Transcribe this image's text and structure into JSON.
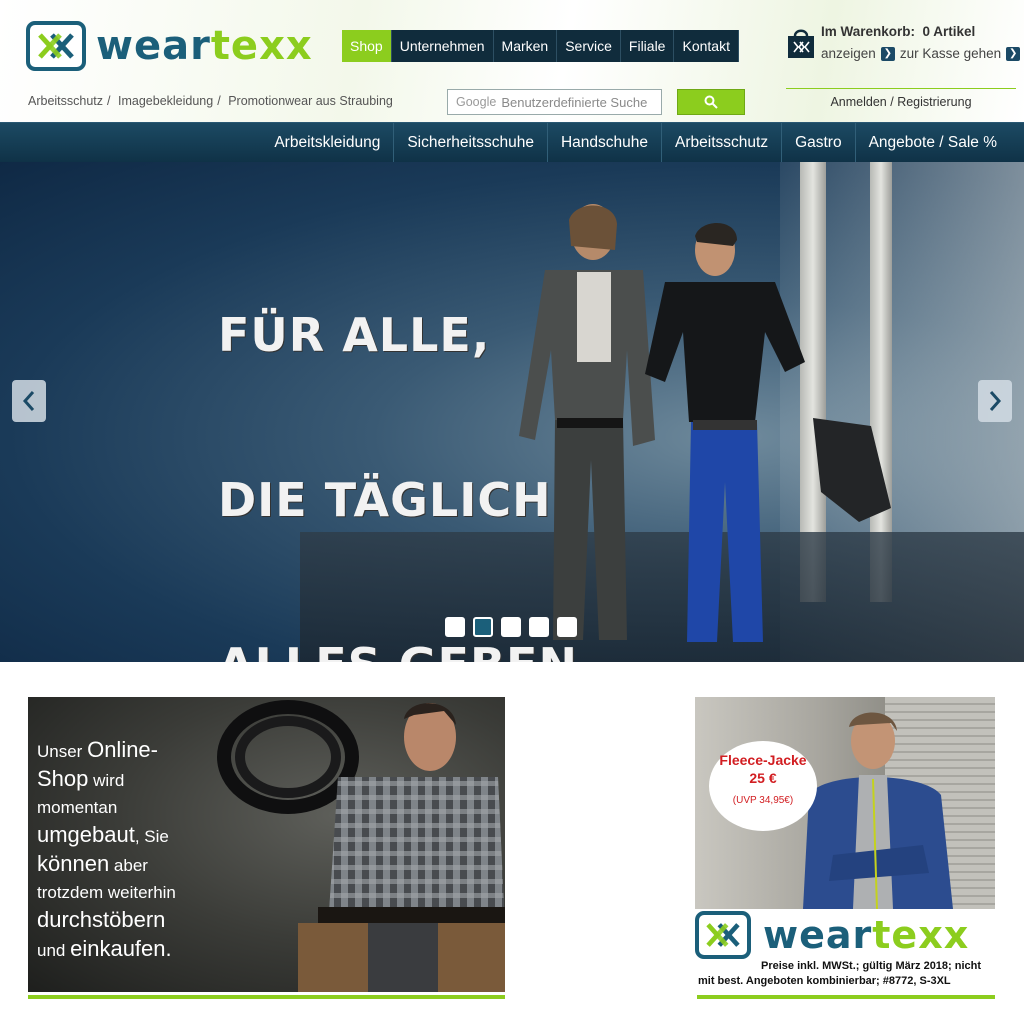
{
  "brand": {
    "part1": "wear",
    "part2": "texx",
    "primary": "#1b5f7a",
    "accent": "#8ccd1e",
    "dark": "#102c3c"
  },
  "topnav": {
    "items": [
      {
        "label": "Shop",
        "active": true
      },
      {
        "label": "Unternehmen"
      },
      {
        "label": "Marken"
      },
      {
        "label": "Service"
      },
      {
        "label": "Filiale"
      },
      {
        "label": "Kontakt"
      }
    ]
  },
  "cart": {
    "label": "Im Warenkorb:",
    "count": "0 Artikel",
    "show": "anzeigen",
    "checkout": "zur Kasse gehen",
    "icon": "shopping-bag-icon"
  },
  "breadcrumb": {
    "items": [
      "Arbeitsschutz",
      "Imagebekleidung",
      "Promotionwear aus Straubing"
    ]
  },
  "search": {
    "brand": "Google",
    "placeholder": "Benutzerdefinierte Suche",
    "button_icon": "search-icon"
  },
  "account": {
    "login": "Anmelden",
    "register": "Registrierung"
  },
  "categories": [
    "Arbeitskleidung",
    "Sicherheitsschuhe",
    "Handschuhe",
    "Arbeitsschutz",
    "Gastro",
    "Angebote / Sale %"
  ],
  "hero": {
    "lines": [
      "FÜR ALLE,",
      "DIE TÄGLICH",
      "ALLES GEBEN"
    ],
    "slides": 5,
    "active_slide": 2
  },
  "promo_left": {
    "lines": [
      {
        "parts": [
          {
            "t": "Unser ",
            "s": 1
          },
          {
            "t": "Online-",
            "s": 2
          }
        ]
      },
      {
        "parts": [
          {
            "t": "Shop",
            "s": 2
          },
          {
            "t": " wird",
            "s": 1
          }
        ]
      },
      {
        "parts": [
          {
            "t": "momentan",
            "s": 1
          }
        ]
      },
      {
        "parts": [
          {
            "t": "umgebaut",
            "s": 2
          },
          {
            "t": ", Sie",
            "s": 1
          }
        ]
      },
      {
        "parts": [
          {
            "t": "können",
            "s": 2
          },
          {
            "t": " aber",
            "s": 1
          }
        ]
      },
      {
        "parts": [
          {
            "t": "trotzdem weiterhin",
            "s": 1
          }
        ]
      },
      {
        "parts": [
          {
            "t": "durchstöbern",
            "s": 2
          }
        ]
      },
      {
        "parts": [
          {
            "t": "und ",
            "s": 1
          },
          {
            "t": "einkaufen.",
            "s": 2
          }
        ]
      }
    ]
  },
  "promo_right": {
    "badge_title": "Fleece-Jacke",
    "badge_price": "25 €",
    "badge_uvp": "(UVP 34,95€)",
    "fine_line1": "Preise inkl. MWSt.; gültig März 2018; nicht",
    "fine_line2": "mit best. Angeboten kombinierbar; #8772, S-3XL"
  }
}
